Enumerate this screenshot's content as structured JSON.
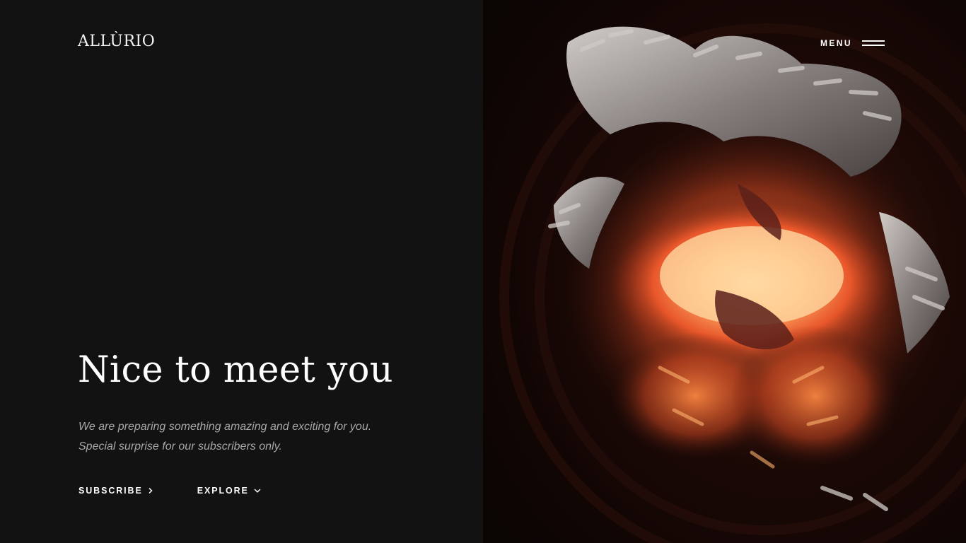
{
  "header": {
    "logo": "ALLÙRIO",
    "menu_label": "MENU"
  },
  "hero": {
    "title": "Nice to meet you",
    "tagline": "We are preparing something amazing and exciting for you. Special surprise for our subscribers only.",
    "actions": [
      {
        "label": "SUBSCRIBE",
        "icon": "chevron-right-icon"
      },
      {
        "label": "EXPLORE",
        "icon": "chevron-down-icon"
      }
    ]
  },
  "colors": {
    "background_left": "#121212",
    "background_right": "#0c0606",
    "text_primary": "#ffffff",
    "text_secondary": "#a7a7a7",
    "glow": "#ff7a2a"
  }
}
